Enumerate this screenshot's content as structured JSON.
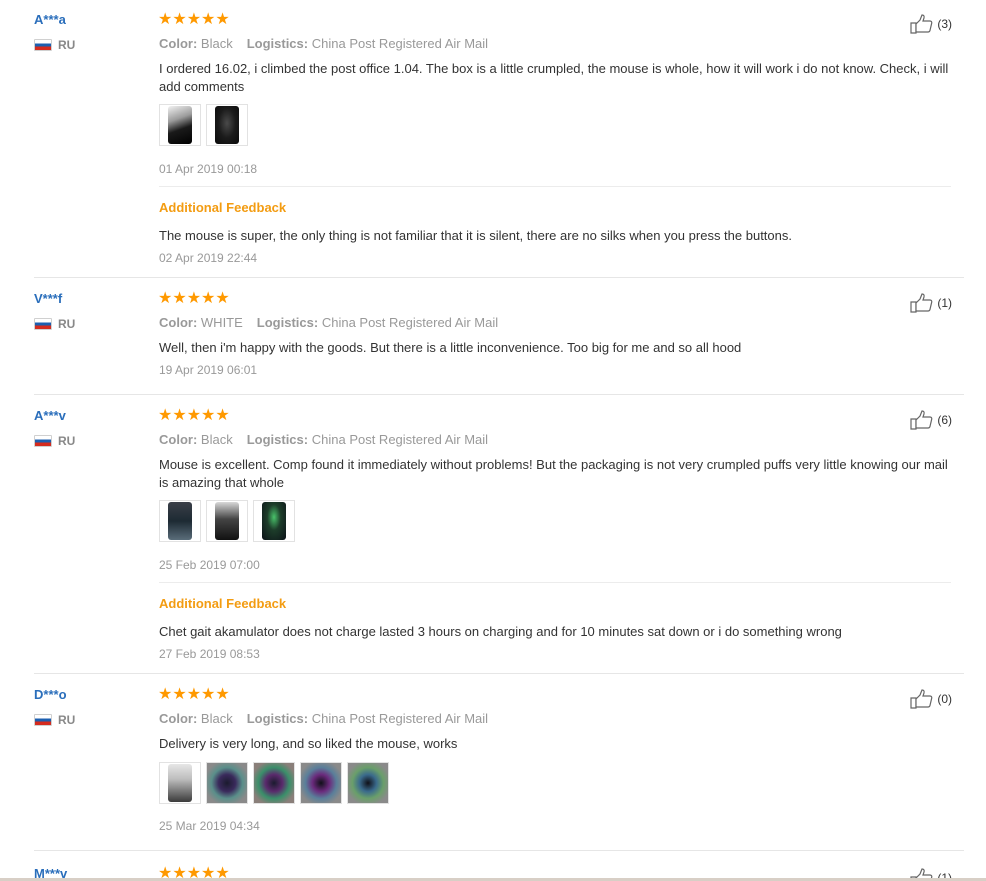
{
  "reviews": [
    {
      "user": "A***a",
      "country": "RU",
      "stars": "★★★★★",
      "color_label": "Color:",
      "color_value": "Black",
      "logistics_label": "Logistics:",
      "logistics_value": "China Post Registered Air Mail",
      "text": "I ordered 16.02, i climbed the post office 1.04. The box is a little crumpled, the mouse is whole, how it will work i do not know. Check, i will add comments",
      "date": "01 Apr 2019 00:18",
      "helpful_count": "(3)",
      "additional_label": "Additional Feedback",
      "additional_text": "The mouse is super, the only thing is not familiar that it is silent, there are no silks when you press the buttons.",
      "additional_date": "02 Apr 2019 22:44"
    },
    {
      "user": "V***f",
      "country": "RU",
      "stars": "★★★★★",
      "color_label": "Color:",
      "color_value": "WHITE",
      "logistics_label": "Logistics:",
      "logistics_value": "China Post Registered Air Mail",
      "text": "Well, then i'm happy with the goods. But there is a little inconvenience. Too big for me and so all hood",
      "date": "19 Apr 2019 06:01",
      "helpful_count": "(1)"
    },
    {
      "user": "A***v",
      "country": "RU",
      "stars": "★★★★★",
      "color_label": "Color:",
      "color_value": "Black",
      "logistics_label": "Logistics:",
      "logistics_value": "China Post Registered Air Mail",
      "text": "Mouse is excellent. Comp found it immediately without problems! But the packaging is not very crumpled puffs very little knowing our mail is amazing that whole",
      "date": "25 Feb 2019 07:00",
      "helpful_count": "(6)",
      "additional_label": "Additional Feedback",
      "additional_text": "Chet gait akamulator does not charge lasted 3 hours on charging and for 10 minutes sat down or i do something wrong",
      "additional_date": "27 Feb 2019 08:53"
    },
    {
      "user": "D***o",
      "country": "RU",
      "stars": "★★★★★",
      "color_label": "Color:",
      "color_value": "Black",
      "logistics_label": "Logistics:",
      "logistics_value": "China Post Registered Air Mail",
      "text": "Delivery is very long, and so liked the mouse, works",
      "date": "25 Mar 2019 04:34",
      "helpful_count": "(0)"
    },
    {
      "user": "M***v",
      "stars": "★★★★★",
      "helpful_count": "(1)"
    }
  ],
  "icons": {
    "thumbs_up": "thumbs-up-icon",
    "flag": "russia-flag-icon"
  },
  "colors": {
    "username": "#2a6ebb",
    "stars": "#ff9900",
    "additional_feedback": "#f39c12",
    "meta": "#999999"
  }
}
